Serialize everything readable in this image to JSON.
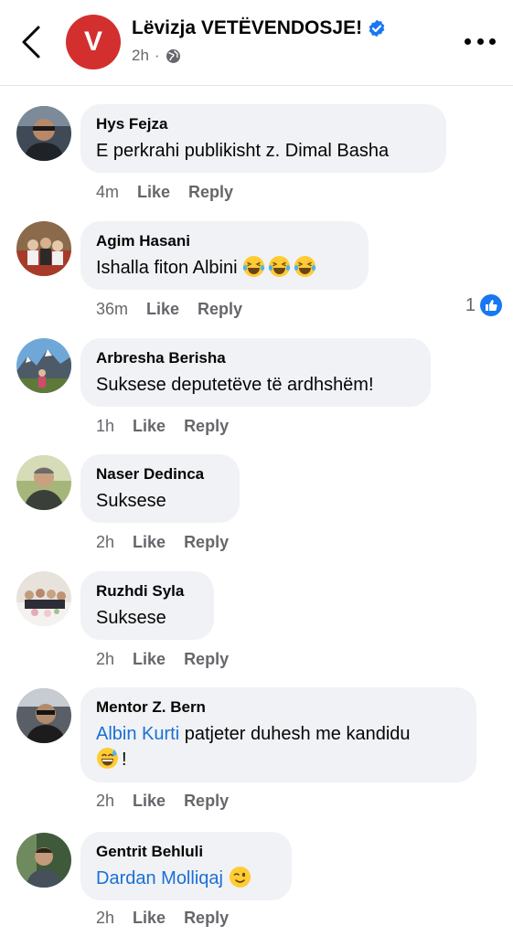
{
  "header": {
    "page_name": "Lëvizja VETËVENDOSJE!",
    "logo_letter": "V",
    "time": "2h",
    "separator": "·",
    "verified_icon": "verified-badge-icon",
    "privacy_icon": "globe-icon"
  },
  "colors": {
    "accent": "#1877f2",
    "brand": "#d32f2f",
    "bubble": "#f0f2f5",
    "muted": "#65676b"
  },
  "actions": {
    "like": "Like",
    "reply": "Reply"
  },
  "comments": [
    {
      "author": "Hys Fejza",
      "text": "E perkrahi publikisht z. Dimal Basha",
      "time": "4m"
    },
    {
      "author": "Agim Hasani",
      "text": "Ishalla fiton Albini",
      "emoji": [
        "laughing-tears-emoji",
        "laughing-tears-emoji",
        "laughing-tears-emoji"
      ],
      "time": "36m",
      "reaction_count": "1"
    },
    {
      "author": "Arbresha Berisha",
      "text": "Suksese deputetëve të ardhshëm!",
      "time": "1h"
    },
    {
      "author": "Naser Dedinca",
      "text": "Suksese",
      "time": "2h"
    },
    {
      "author": "Ruzhdi Syla",
      "text": "Suksese",
      "time": "2h"
    },
    {
      "author": "Mentor Z. Bern",
      "mention": "Albin Kurti",
      "text": " patjeter duhesh me kandidu",
      "text_end": "!",
      "emoji": [
        "grinning-sweat-emoji"
      ],
      "time": "2h"
    },
    {
      "author": "Gentrit Behluli",
      "mention": "Dardan Molliqaj",
      "emoji": [
        "winking-face-emoji"
      ],
      "time": "2h"
    }
  ]
}
